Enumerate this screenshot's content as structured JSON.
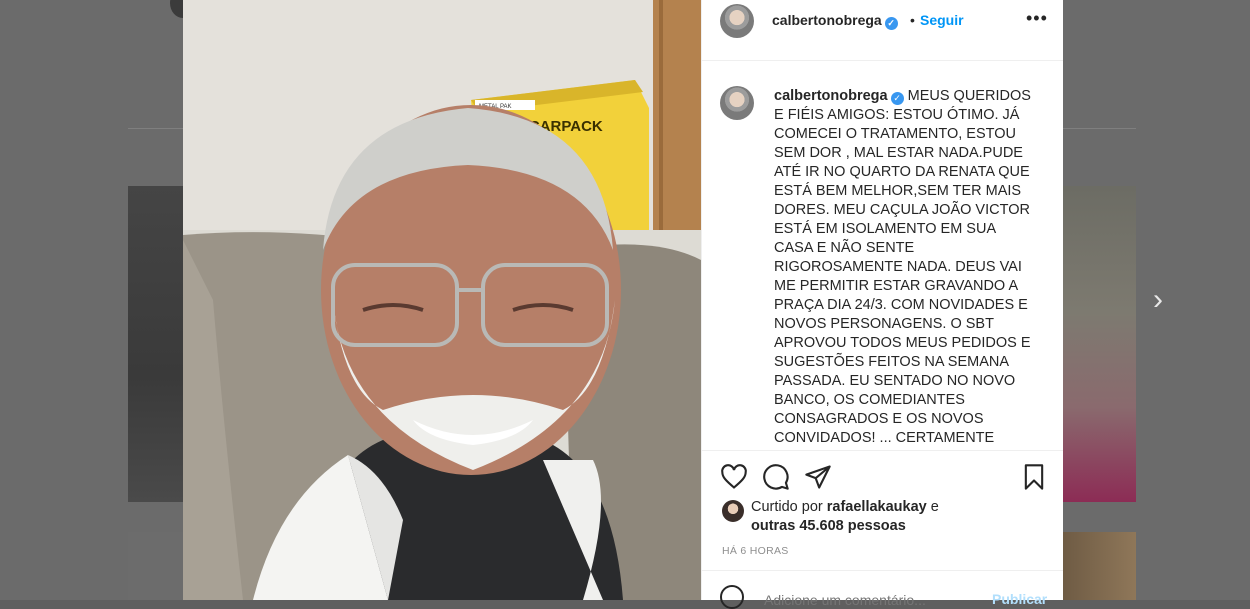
{
  "post": {
    "username": "calbertonobrega",
    "follow_label": "Seguir",
    "separator": "•",
    "more_label": "•••",
    "caption": "MEUS QUERIDOS E FIÉIS AMIGOS: ESTOU ÓTIMO. JÁ COMECEI O TRATAMENTO, ESTOU SEM DOR , MAL ESTAR NADA.PUDE ATÉ IR NO QUARTO DA RENATA QUE ESTÁ BEM MELHOR,SEM TER MAIS DORES. MEU CAÇULA JOÃO VICTOR ESTÁ EM ISOLAMENTO EM SUA CASA E NÃO SENTE RIGOROSAMENTE NADA. DEUS VAI ME PERMITIR ESTAR GRAVANDO A PRAÇA DIA 24/3. COM NOVIDADES E NOVOS PERSONAGENS. O SBT APROVOU TODOS MEUS PEDIDOS E SUGESTÕES FEITOS NA SEMANA PASSADA. EU SENTADO NO NOVO BANCO, OS COMEDIANTES CONSAGRADOS E OS NOVOS CONVIDADOS! ... CERTAMENTE VAMOS COLOCAR A",
    "likes_prefix": "Curtido por",
    "likes_user": "rafaellakaukay",
    "likes_middle": "e",
    "likes_count": "outras 45.608 pessoas",
    "timestamp": "HÁ 6 HORAS",
    "comment_placeholder": "Adicione um comentário...",
    "publish_label": "Publicar",
    "photo_sign_text": "DESCARPACK",
    "photo_sign_small": "METAL PAK"
  },
  "navigation": {
    "next_label": "›"
  },
  "colors": {
    "accent": "#0095f6",
    "verified": "#3897f0",
    "text": "#262626",
    "muted": "#8e8e8e",
    "sign_yellow": "#f2d13a"
  }
}
